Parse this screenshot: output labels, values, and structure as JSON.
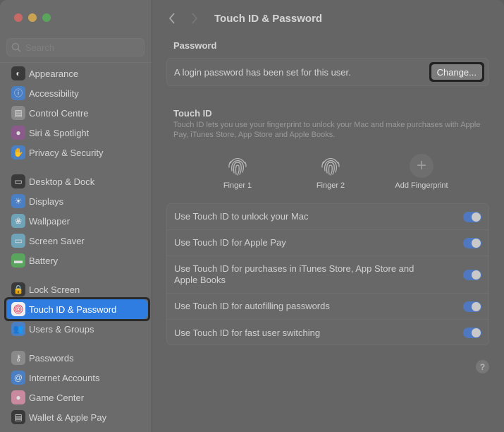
{
  "window": {
    "controls": [
      "close",
      "minimize",
      "zoom"
    ]
  },
  "sidebar": {
    "search_placeholder": "Search",
    "groups": [
      [
        {
          "label": "Appearance",
          "icon": "appearance-icon",
          "color": "#3a3a3a",
          "glyph": "◐"
        },
        {
          "label": "Accessibility",
          "icon": "accessibility-icon",
          "color": "#4a7fc4",
          "glyph": "ⓘ"
        },
        {
          "label": "Control Centre",
          "icon": "control-centre-icon",
          "color": "#8a8a8a",
          "glyph": "▤"
        },
        {
          "label": "Siri & Spotlight",
          "icon": "siri-icon",
          "color": "#8a5a8a",
          "glyph": "●"
        },
        {
          "label": "Privacy & Security",
          "icon": "hand-icon",
          "color": "#4a7fc4",
          "glyph": "✋"
        }
      ],
      [
        {
          "label": "Desktop & Dock",
          "icon": "desktop-dock-icon",
          "color": "#3a3a3a",
          "glyph": "▭"
        },
        {
          "label": "Displays",
          "icon": "displays-icon",
          "color": "#4a7fc4",
          "glyph": "☀"
        },
        {
          "label": "Wallpaper",
          "icon": "wallpaper-icon",
          "color": "#6fa3b8",
          "glyph": "❀"
        },
        {
          "label": "Screen Saver",
          "icon": "screen-saver-icon",
          "color": "#6fa3b8",
          "glyph": "▭"
        },
        {
          "label": "Battery",
          "icon": "battery-icon",
          "color": "#5aa55d",
          "glyph": "▬"
        }
      ],
      [
        {
          "label": "Lock Screen",
          "icon": "lock-icon",
          "color": "#3a3a3a",
          "glyph": "🔒"
        },
        {
          "label": "Touch ID & Password",
          "icon": "fingerprint-icon",
          "color": "#f1f1f1",
          "glyph": "◎",
          "selected": true
        },
        {
          "label": "Users & Groups",
          "icon": "users-icon",
          "color": "#4a7fc4",
          "glyph": "👥"
        }
      ],
      [
        {
          "label": "Passwords",
          "icon": "key-icon",
          "color": "#8a8a8a",
          "glyph": "⚷"
        },
        {
          "label": "Internet Accounts",
          "icon": "at-icon",
          "color": "#4a7fc4",
          "glyph": "@"
        },
        {
          "label": "Game Center",
          "icon": "game-center-icon",
          "color": "#c98aa0",
          "glyph": "●"
        },
        {
          "label": "Wallet & Apple Pay",
          "icon": "wallet-icon",
          "color": "#3a3a3a",
          "glyph": "▤"
        }
      ]
    ]
  },
  "main": {
    "title": "Touch ID & Password",
    "password": {
      "section_title": "Password",
      "status_text": "A login password has been set for this user.",
      "change_label": "Change..."
    },
    "touch_id": {
      "section_title": "Touch ID",
      "description": "Touch ID lets you use your fingerprint to unlock your Mac and make purchases with Apple Pay, iTunes Store, App Store and Apple Books.",
      "fingers": [
        {
          "label": "Finger 1"
        },
        {
          "label": "Finger 2"
        }
      ],
      "add_label": "Add Fingerprint"
    },
    "toggles": [
      {
        "label": "Use Touch ID to unlock your Mac",
        "on": true
      },
      {
        "label": "Use Touch ID for Apple Pay",
        "on": true
      },
      {
        "label": "Use Touch ID for purchases in iTunes Store, App Store and Apple Books",
        "on": true
      },
      {
        "label": "Use Touch ID for autofilling passwords",
        "on": true
      },
      {
        "label": "Use Touch ID for fast user switching",
        "on": true
      }
    ],
    "help_label": "?"
  },
  "colors": {
    "accent": "#2f7de0",
    "toggle_on": "#4f78c0"
  }
}
